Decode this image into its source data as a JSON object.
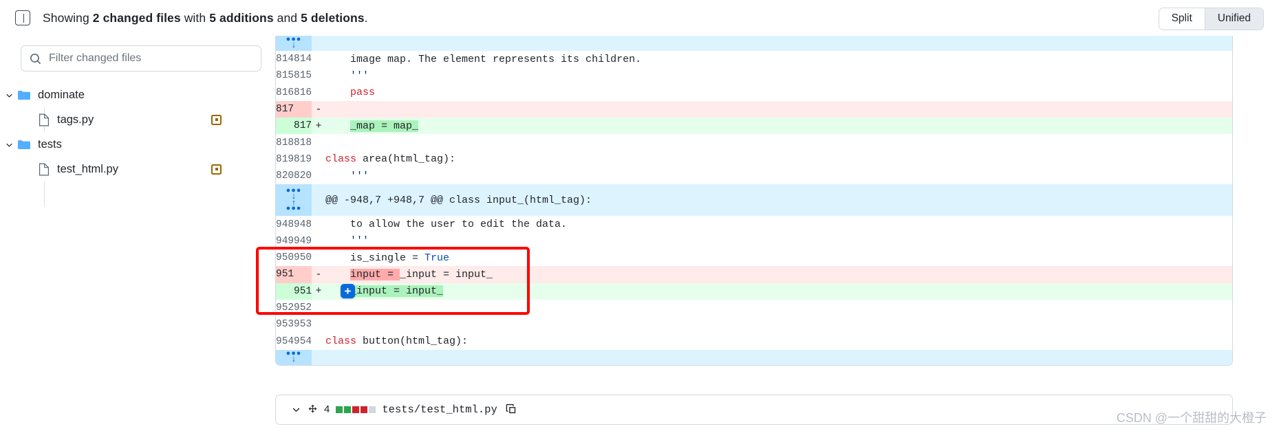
{
  "header": {
    "sidebar_toggle_icon": "sidebar-collapse-icon",
    "showing_prefix": "Showing ",
    "changed_files_count": "2 changed files",
    "with_text": " with ",
    "additions": "5 additions",
    "and_text": " and ",
    "deletions": "5 deletions",
    "period": ".",
    "view_toggle": {
      "split_label": "Split",
      "unified_label": "Unified",
      "selected": "Unified"
    }
  },
  "sidebar": {
    "filter": {
      "placeholder": "Filter changed files",
      "value": "",
      "icon": "search-icon"
    },
    "tree": [
      {
        "type": "folder",
        "label": "dominate",
        "expanded": true,
        "icon": "folder-icon"
      },
      {
        "type": "file",
        "label": "tags.py",
        "icon": "file-icon",
        "status": "modified",
        "status_icon": "dot-square-icon"
      },
      {
        "type": "folder",
        "label": "tests",
        "expanded": true,
        "icon": "folder-icon"
      },
      {
        "type": "file",
        "label": "test_html.py",
        "icon": "file-icon",
        "status": "modified",
        "status_icon": "dot-square-icon"
      }
    ]
  },
  "diff": {
    "rows": [
      {
        "kind": "expand",
        "old": "",
        "new": "",
        "mark": "",
        "code": ""
      },
      {
        "kind": "ctx",
        "old": "814",
        "new": "814",
        "mark": "",
        "code": "    image map. The element represents its children."
      },
      {
        "kind": "ctx",
        "old": "815",
        "new": "815",
        "mark": "",
        "code": "    '''"
      },
      {
        "kind": "ctx",
        "old": "816",
        "new": "816",
        "mark": "",
        "code": "    pass"
      },
      {
        "kind": "del",
        "old": "817",
        "new": "",
        "mark": "-",
        "code": ""
      },
      {
        "kind": "add",
        "old": "",
        "new": "817",
        "mark": "+",
        "code": "    _map = map_"
      },
      {
        "kind": "ctx",
        "old": "818",
        "new": "818",
        "mark": "",
        "code": ""
      },
      {
        "kind": "ctx",
        "old": "819",
        "new": "819",
        "mark": "",
        "code": "class area(html_tag):"
      },
      {
        "kind": "ctx",
        "old": "820",
        "new": "820",
        "mark": "",
        "code": "    '''"
      },
      {
        "kind": "hunk",
        "old": "",
        "new": "",
        "mark": "",
        "code": "@@ -948,7 +948,7 @@ class input_(html_tag):"
      },
      {
        "kind": "ctx",
        "old": "948",
        "new": "948",
        "mark": "",
        "code": "    to allow the user to edit the data."
      },
      {
        "kind": "ctx",
        "old": "949",
        "new": "949",
        "mark": "",
        "code": "    '''"
      },
      {
        "kind": "ctx",
        "old": "950",
        "new": "950",
        "mark": "",
        "code": "    is_single = True"
      },
      {
        "kind": "del",
        "old": "951",
        "new": "",
        "mark": "-",
        "code": "    input = _input = input_"
      },
      {
        "kind": "add",
        "old": "",
        "new": "951",
        "mark": "+",
        "code": "    _input = input_"
      },
      {
        "kind": "ctx",
        "old": "952",
        "new": "952",
        "mark": "",
        "code": ""
      },
      {
        "kind": "ctx",
        "old": "953",
        "new": "953",
        "mark": "",
        "code": ""
      },
      {
        "kind": "ctx",
        "old": "954",
        "new": "954",
        "mark": "",
        "code": "class button(html_tag):"
      },
      {
        "kind": "expand",
        "old": "",
        "new": "",
        "mark": "",
        "code": ""
      }
    ],
    "hunk_expand_down_icon": "arrow-down-icon",
    "hunk_expand_up_icon": "arrow-up-icon",
    "add_comment_button_label": "+"
  },
  "next_file_header": {
    "collapse_icon": "chevron-down-icon",
    "drag_icon": "drag-handle-icon",
    "change_count": "4",
    "stat_blocks": [
      "#2da44e",
      "#2da44e",
      "#cf222e",
      "#cf222e",
      "#d0d7de"
    ],
    "path": "tests/test_html.py",
    "copy_icon": "copy-icon"
  },
  "watermark": "CSDN @一个甜甜的大橙子"
}
